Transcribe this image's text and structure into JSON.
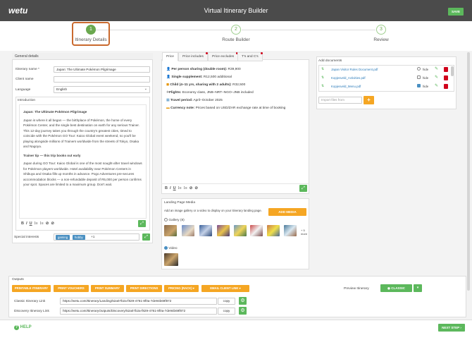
{
  "app": {
    "logo": "wetu",
    "title": "Virtual Itinerary Builder",
    "save_label": "SAVE"
  },
  "stepper": [
    {
      "num": "1",
      "label": "Itinerary Details"
    },
    {
      "num": "2",
      "label": "Route Builder"
    },
    {
      "num": "3",
      "label": "Review"
    }
  ],
  "general": {
    "header": "General details",
    "name_label": "Itinerary name *",
    "name_value": "Japan: The Ultimate Pokémon Pilgrimage",
    "client_label": "Client name",
    "client_value": "",
    "language_label": "Language",
    "language_value": "English"
  },
  "intro": {
    "header": "Introduction",
    "heading1": "Japan: The Ultimate Pokémon Pilgrimage",
    "para1": "Japan is where it all began — the birthplace of Pokémon, the home of every Pokémon Center, and the single best destination on earth for any serious Trainer. This 12-day journey takes you through the country's greatest cities, timed to coincide with the Pokémon GO Tour: Kaioo Global event weekend, so you'll be playing alongside millions of Trainers worldwide from the streets of Tokyo, Osaka and Nagoya.",
    "heading2": "Trainer tip — this trip books out early",
    "para2": "Japan during GO Tour: Kaioo Global is one of the most sought-after travel windows for Pokémon players worldwide. Hotel availability near Pokémon Centers in Shibuya and Osaka fills up months in advance. Pogo Adventures pre-secures accommodation blocks — a non-refundable deposit of R5,000 per person confirms your spot. Spaces are limited to a maximum group. Don't wait."
  },
  "special": {
    "label": "Special interests",
    "tags": [
      "gaming",
      "hobby"
    ],
    "more": "+1"
  },
  "price_tabs": [
    "Price",
    "Price includes",
    "Price excludes",
    "T's and C's"
  ],
  "price_lines": [
    {
      "icon": "person-icon",
      "bold": "Per person sharing (double room):",
      "text": " R39,900"
    },
    {
      "icon": "person-icon",
      "bold": "Single supplement:",
      "text": " R12,500 additional"
    },
    {
      "icon": "child-icon",
      "bold": "Child (4–11 yrs, sharing with 2 adults):",
      "text": " R32,500"
    },
    {
      "icon": "plane-icon",
      "bold": "Flights:",
      "text": " Economy class, JNB–NRT–NGO–JNB included"
    },
    {
      "icon": "calendar-icon",
      "bold": "Travel period:",
      "text": " April–October 2025"
    },
    {
      "icon": "money-icon",
      "bold": "Currency note:",
      "text": " Prices based on USD/ZAR exchange rate at time of booking"
    }
  ],
  "media": {
    "header": "Landing Page Media",
    "desc": "Add an image gallery or a video to display on your itinerary landing page.",
    "add_label": "ADD MEDIA",
    "gallery_label": "Gallery (8)",
    "more_label": "+ 5 more",
    "video_label": "Video"
  },
  "documents": {
    "header": "Add documents",
    "rows": [
      {
        "name": "Japan Visitor Rules Document.pdf",
        "hide": "hide",
        "checked": false
      },
      {
        "name": "Kopjesveld_Activities.pdf",
        "hide": "hide",
        "checked": false
      },
      {
        "name": "Kopjesveld_Menu.pdf",
        "hide": "hide",
        "checked": true
      }
    ],
    "import_placeholder": "Import files from"
  },
  "outputs": {
    "header": "Outputs",
    "buttons": [
      "PRINTABLE ITINERARY",
      "PRINT VOUCHERS",
      "PRINT SUMMARY",
      "PRINT DIRECTIONS",
      "PRICING (RACK)",
      "EMAIL CLIENT LINK"
    ],
    "preview_label": "Preview Itinerary",
    "classic_label": "CLASSIC",
    "links": [
      {
        "label": "Classic Itinerary Link",
        "url": "https://wetu.com/Itinerary/Landing/52a07b2a-f829-4761-8f0a-7de94b69f872",
        "copy": "copy"
      },
      {
        "label": "Discovery Itinerary Link",
        "url": "https://wetu.com/ItineraryOutputs/Discovery/52a07b2a-f829-4761-8f0a-7de94b69f872",
        "copy": "copy"
      }
    ]
  },
  "footer": {
    "help_label": "HELP",
    "next_label": "NEXT STEP"
  },
  "colors": {
    "green": "#5cb85c",
    "orange": "#f5a623",
    "titlebar": "#4b4b4b",
    "highlight": "#c9692e"
  }
}
